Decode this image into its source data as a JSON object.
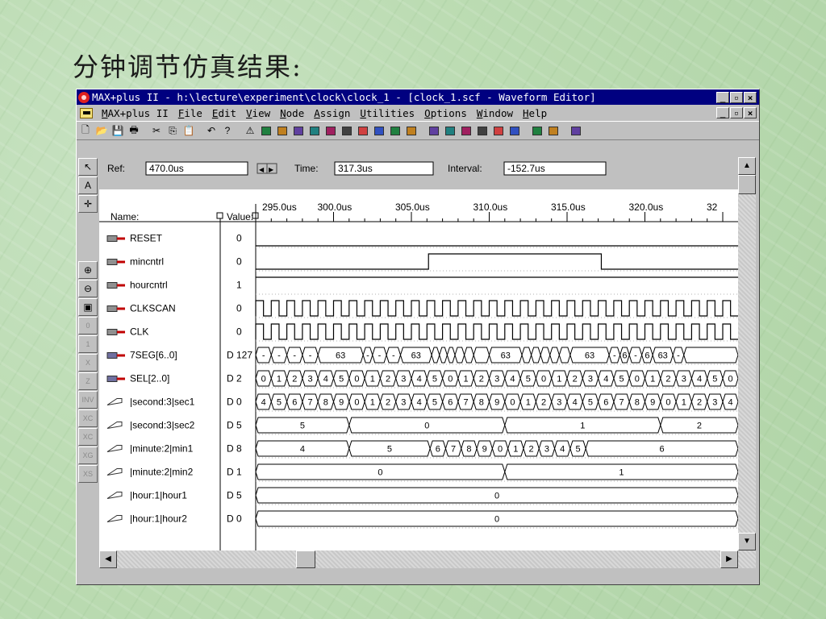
{
  "slide_title": "分钟调节仿真结果:",
  "window": {
    "title": "MAX+plus II - h:\\lecture\\experiment\\clock\\clock_1 - [clock_1.scf - Waveform Editor]",
    "buttons": {
      "minimize": "_",
      "restore": "🗗",
      "close": "×"
    }
  },
  "menu": [
    {
      "pre": "",
      "key": "M",
      "post": "AX+plus II"
    },
    {
      "pre": "",
      "key": "F",
      "post": "ile"
    },
    {
      "pre": "",
      "key": "E",
      "post": "dit"
    },
    {
      "pre": "",
      "key": "V",
      "post": "iew"
    },
    {
      "pre": "",
      "key": "N",
      "post": "ode"
    },
    {
      "pre": "",
      "key": "A",
      "post": "ssign"
    },
    {
      "pre": "",
      "key": "U",
      "post": "tilities"
    },
    {
      "pre": "",
      "key": "O",
      "post": "ptions"
    },
    {
      "pre": "",
      "key": "W",
      "post": "indow"
    },
    {
      "pre": "",
      "key": "H",
      "post": "elp"
    }
  ],
  "toolbar_icons": [
    "new-file-icon",
    "open-folder-icon",
    "save-icon",
    "print-icon",
    "cut-icon",
    "copy-icon",
    "paste-icon",
    "undo-icon",
    "help-pointer-icon",
    "warning-icon",
    "compile-icon",
    "hierarchy-icon",
    "floorplan-icon",
    "symbol-icon",
    "timing-icon",
    "project-icon",
    "simulate-icon",
    "analyzer-icon",
    "programmer-icon",
    "timing-analyzer-icon",
    "message-icon",
    "save-check-icon",
    "save-compile-icon",
    "find-node-icon",
    "find-next-icon",
    "replace-icon",
    "snap-grid-icon",
    "overwrite-icon",
    "zoom-fit-icon"
  ],
  "left_tools": [
    "pointer-tool",
    "text-tool",
    "node-tool",
    "zoom-in-tool",
    "zoom-out-tool",
    "fit-window-tool",
    "set-0-tool",
    "set-1-tool",
    "set-x-tool",
    "set-z-tool",
    "invert-tool",
    "overwrite-count-tool",
    "overwrite-clock-tool",
    "overwrite-gray-tool",
    "group-value-tool"
  ],
  "toolbar": {
    "ref_label": "Ref:",
    "ref_value": "470.0us",
    "time_label": "Time:",
    "time_value": "317.3us",
    "interval_label": "Interval:",
    "interval_value": "-152.7us"
  },
  "headers": {
    "name": "Name:",
    "value": "Value:"
  },
  "time_ticks": [
    "295.0us",
    "300.0us",
    "305.0us",
    "310.0us",
    "315.0us",
    "320.0us",
    "32"
  ],
  "signals": [
    {
      "name": "RESET",
      "value": "0",
      "kind": "input",
      "wave": {
        "type": "level",
        "segments": [
          [
            295,
            0
          ]
        ]
      }
    },
    {
      "name": "mincntrl",
      "value": "0",
      "kind": "input",
      "wave": {
        "type": "level",
        "segments": [
          [
            295,
            0
          ],
          [
            306.1,
            1
          ],
          [
            317.2,
            0
          ]
        ]
      }
    },
    {
      "name": "hourcntrl",
      "value": "1",
      "kind": "input",
      "wave": {
        "type": "level",
        "segments": [
          [
            295,
            1
          ]
        ]
      }
    },
    {
      "name": "CLKSCAN",
      "value": "0",
      "kind": "input",
      "wave": {
        "type": "clock",
        "half": 0.5,
        "start": 295
      }
    },
    {
      "name": "CLK",
      "value": "0",
      "kind": "input",
      "wave": {
        "type": "clock",
        "half": 0.5,
        "start": 295
      }
    },
    {
      "name": "7SEG[6..0]",
      "value": "D 127",
      "kind": "bus-out",
      "wave": {
        "type": "bus",
        "segments": [
          [
            295,
            "-"
          ],
          [
            296,
            "-"
          ],
          [
            297,
            "-"
          ],
          [
            298,
            "-"
          ],
          [
            299,
            "63"
          ],
          [
            301.9,
            "-"
          ],
          [
            302.5,
            "-"
          ],
          [
            303.4,
            "-"
          ],
          [
            304.3,
            "63"
          ],
          [
            306.3,
            ""
          ],
          [
            306.8,
            ""
          ],
          [
            307.3,
            ""
          ],
          [
            307.8,
            ""
          ],
          [
            308.4,
            ""
          ],
          [
            309,
            ""
          ],
          [
            310,
            "63"
          ],
          [
            312.1,
            ""
          ],
          [
            312.7,
            ""
          ],
          [
            313.3,
            ""
          ],
          [
            313.9,
            ""
          ],
          [
            314.5,
            ""
          ],
          [
            315.2,
            "63"
          ],
          [
            317.7,
            "-"
          ],
          [
            318.4,
            "6"
          ],
          [
            319,
            "-"
          ],
          [
            319.8,
            "6"
          ],
          [
            320.5,
            "63"
          ],
          [
            321.8,
            "-"
          ],
          [
            322.5,
            ""
          ]
        ]
      }
    },
    {
      "name": "SEL[2..0]",
      "value": "D 2",
      "kind": "bus-out",
      "wave": {
        "type": "bus",
        "segments": [
          [
            295,
            "0"
          ],
          [
            296,
            "1"
          ],
          [
            297,
            "2"
          ],
          [
            298,
            "3"
          ],
          [
            299,
            "4"
          ],
          [
            300,
            "5"
          ],
          [
            301,
            "0"
          ],
          [
            302,
            "1"
          ],
          [
            303,
            "2"
          ],
          [
            304,
            "3"
          ],
          [
            305,
            "4"
          ],
          [
            306,
            "5"
          ],
          [
            307,
            "0"
          ],
          [
            308,
            "1"
          ],
          [
            309,
            "2"
          ],
          [
            310,
            "3"
          ],
          [
            311,
            "4"
          ],
          [
            312,
            "5"
          ],
          [
            313,
            "0"
          ],
          [
            314,
            "1"
          ],
          [
            315,
            "2"
          ],
          [
            316,
            "3"
          ],
          [
            317,
            "4"
          ],
          [
            318,
            "5"
          ],
          [
            319,
            "0"
          ],
          [
            320,
            "1"
          ],
          [
            321,
            "2"
          ],
          [
            322,
            "3"
          ],
          [
            323,
            "4"
          ],
          [
            324,
            "5"
          ],
          [
            325,
            "0"
          ]
        ]
      }
    },
    {
      "name": "|second:3|sec1",
      "value": "D 0",
      "kind": "bus-node",
      "wave": {
        "type": "bus",
        "segments": [
          [
            295,
            "4"
          ],
          [
            296,
            "5"
          ],
          [
            297,
            "6"
          ],
          [
            298,
            "7"
          ],
          [
            299,
            "8"
          ],
          [
            300,
            "9"
          ],
          [
            301,
            "0"
          ],
          [
            302,
            "1"
          ],
          [
            303,
            "2"
          ],
          [
            304,
            "3"
          ],
          [
            305,
            "4"
          ],
          [
            306,
            "5"
          ],
          [
            307,
            "6"
          ],
          [
            308,
            "7"
          ],
          [
            309,
            "8"
          ],
          [
            310,
            "9"
          ],
          [
            311,
            "0"
          ],
          [
            312,
            "1"
          ],
          [
            313,
            "2"
          ],
          [
            314,
            "3"
          ],
          [
            315,
            "4"
          ],
          [
            316,
            "5"
          ],
          [
            317,
            "6"
          ],
          [
            318,
            "7"
          ],
          [
            319,
            "8"
          ],
          [
            320,
            "9"
          ],
          [
            321,
            "0"
          ],
          [
            322,
            "1"
          ],
          [
            323,
            "2"
          ],
          [
            324,
            "3"
          ],
          [
            325,
            "4"
          ]
        ]
      }
    },
    {
      "name": "|second:3|sec2",
      "value": "D 5",
      "kind": "bus-node",
      "wave": {
        "type": "bus",
        "segments": [
          [
            295,
            "5"
          ],
          [
            301,
            "0"
          ],
          [
            311,
            "1"
          ],
          [
            321,
            "2"
          ]
        ]
      }
    },
    {
      "name": "|minute:2|min1",
      "value": "D 8",
      "kind": "bus-node",
      "wave": {
        "type": "bus",
        "segments": [
          [
            295,
            "4"
          ],
          [
            301,
            "5"
          ],
          [
            306.2,
            "6"
          ],
          [
            307.2,
            "7"
          ],
          [
            308.2,
            "8"
          ],
          [
            309.2,
            "9"
          ],
          [
            310.2,
            "0"
          ],
          [
            311.2,
            "1"
          ],
          [
            312.2,
            "2"
          ],
          [
            313.2,
            "3"
          ],
          [
            314.2,
            "4"
          ],
          [
            315.2,
            "5"
          ],
          [
            316.2,
            "6"
          ]
        ]
      }
    },
    {
      "name": "|minute:2|min2",
      "value": "D 1",
      "kind": "bus-node",
      "wave": {
        "type": "bus",
        "segments": [
          [
            295,
            "0"
          ],
          [
            311,
            "1"
          ]
        ]
      }
    },
    {
      "name": "|hour:1|hour1",
      "value": "D 5",
      "kind": "bus-node",
      "wave": {
        "type": "bus",
        "segments": [
          [
            295,
            "0"
          ]
        ]
      }
    },
    {
      "name": "|hour:1|hour2",
      "value": "D 0",
      "kind": "bus-node",
      "wave": {
        "type": "bus",
        "segments": [
          [
            295,
            "0"
          ]
        ]
      }
    }
  ]
}
